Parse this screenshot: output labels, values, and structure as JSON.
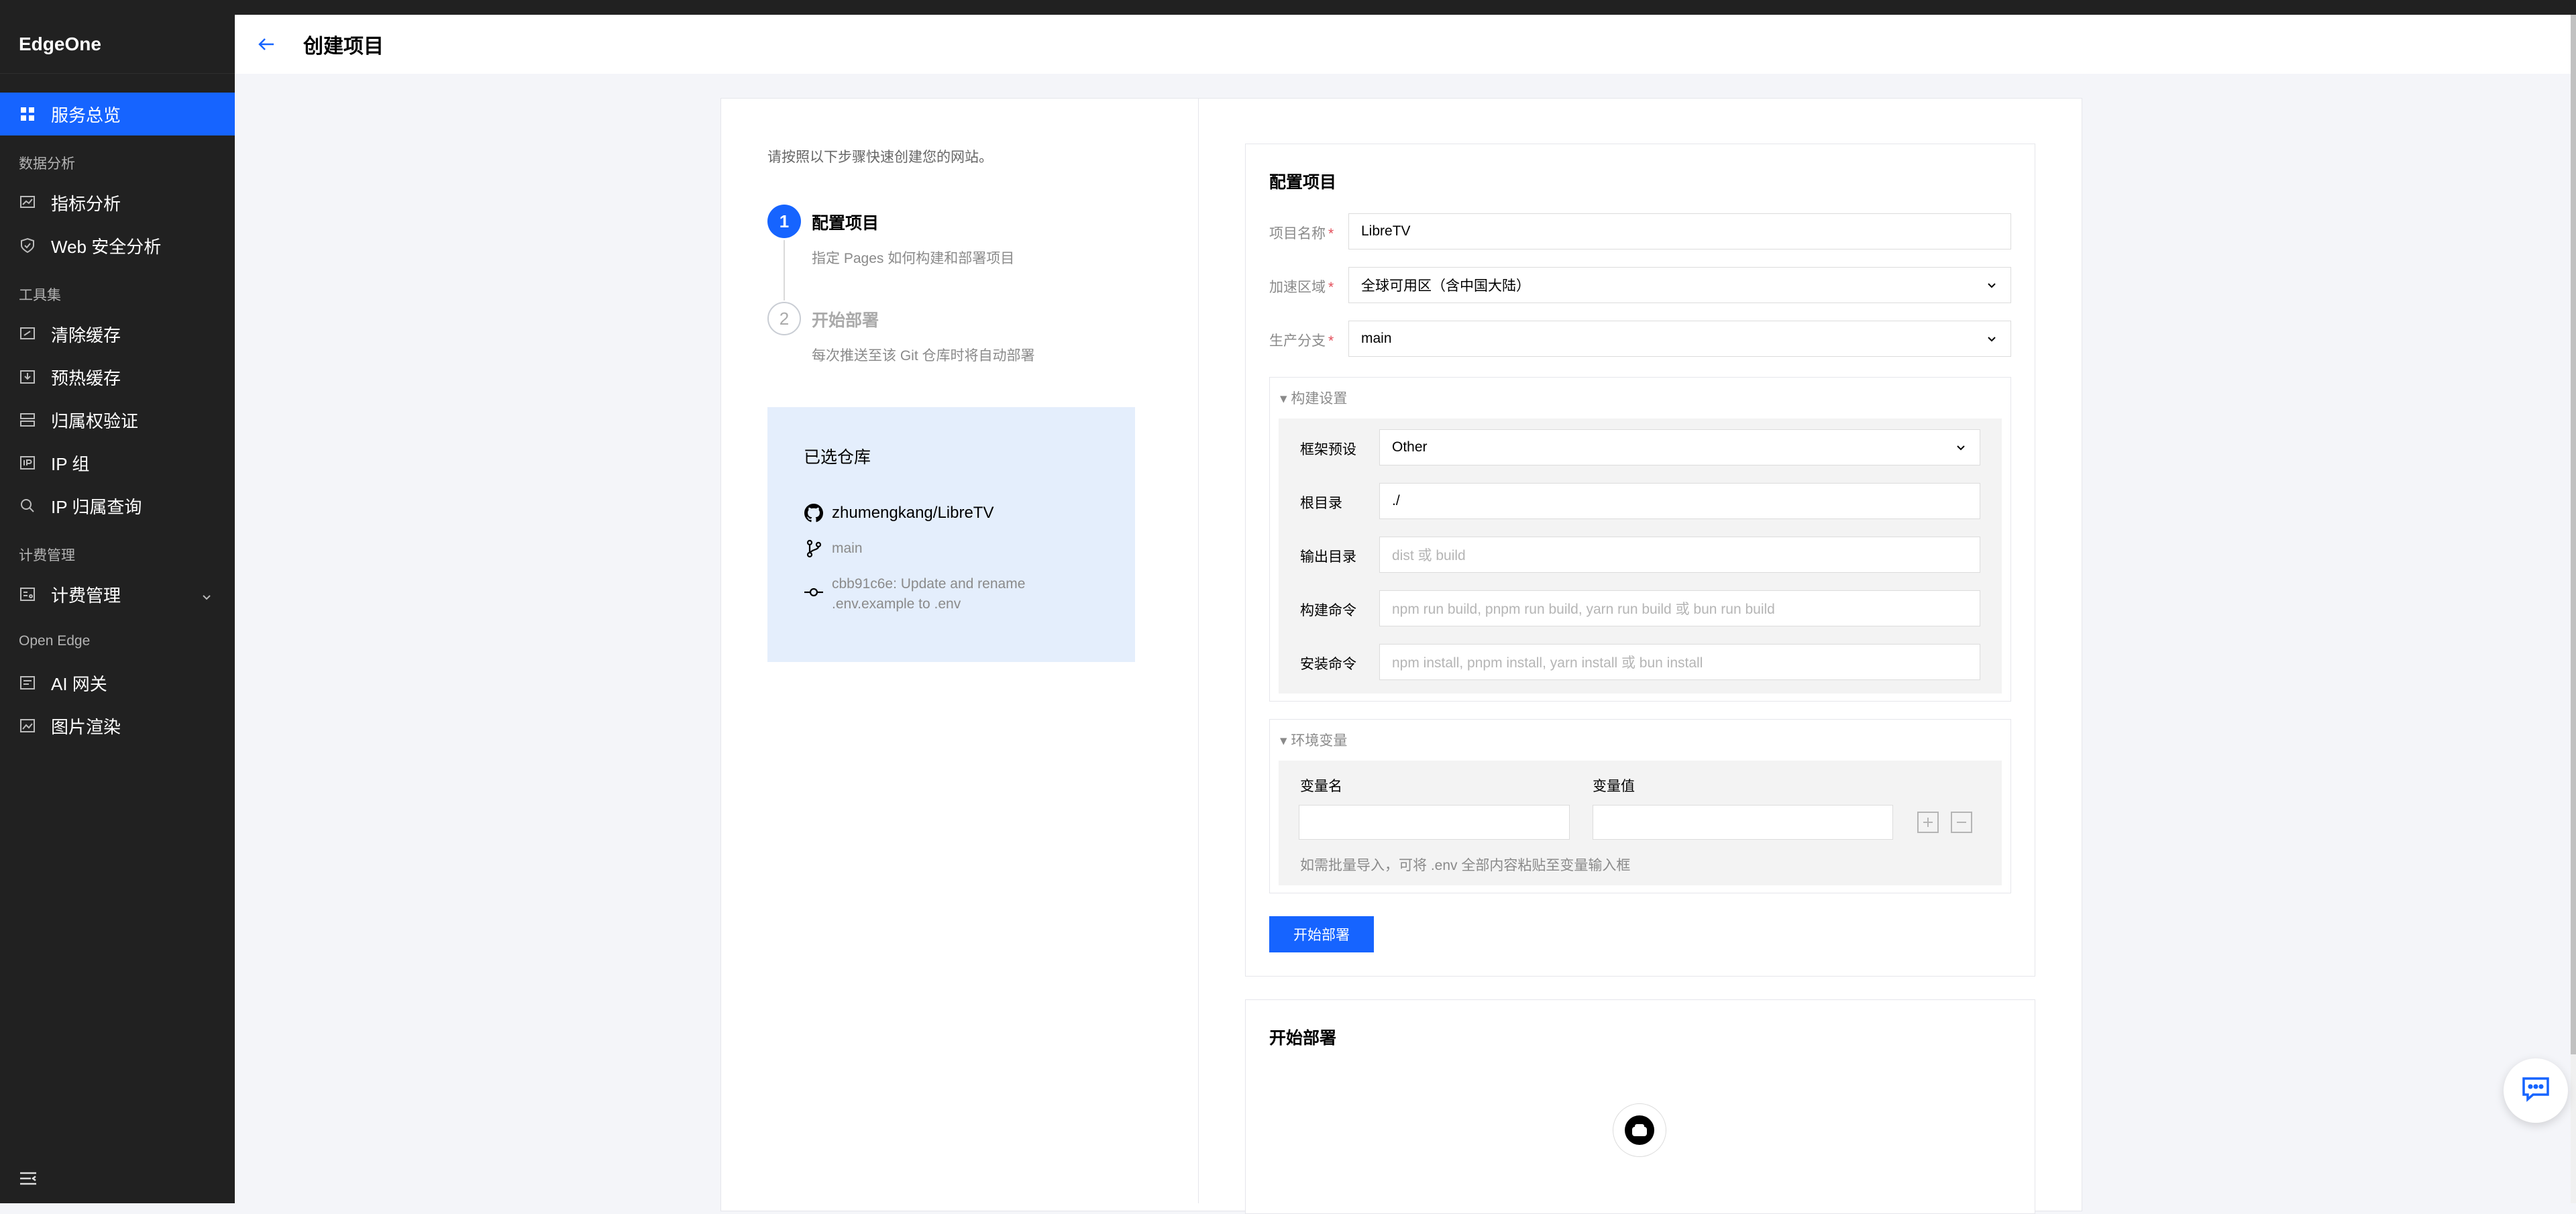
{
  "app": {
    "brand": "EdgeOne"
  },
  "sidebar": {
    "items": [
      {
        "label": "服务总览"
      },
      {
        "label": "指标分析"
      },
      {
        "label": "Web 安全分析"
      },
      {
        "label": "清除缓存"
      },
      {
        "label": "预热缓存"
      },
      {
        "label": "归属权验证"
      },
      {
        "label": "IP 组"
      },
      {
        "label": "IP 归属查询"
      },
      {
        "label": "计费管理"
      },
      {
        "label": "AI 网关"
      },
      {
        "label": "图片渲染"
      }
    ],
    "groups": [
      "数据分析",
      "工具集",
      "计费管理",
      "Open Edge"
    ]
  },
  "header": {
    "title": "创建项目"
  },
  "intro": "请按照以下步骤快速创建您的网站。",
  "steps": [
    {
      "number": "1",
      "title": "配置项目",
      "desc": "指定 Pages 如何构建和部署项目"
    },
    {
      "number": "2",
      "title": "开始部署",
      "desc": "每次推送至该 Git 仓库时将自动部署"
    }
  ],
  "repo": {
    "title": "已选仓库",
    "name": "zhumengkang/LibreTV",
    "branch": "main",
    "commit_line1": "cbb91c6e: Update and rename",
    "commit_line2": ".env.example to .env"
  },
  "form": {
    "title": "配置项目",
    "project_name": {
      "label": "项目名称",
      "value": "LibreTV"
    },
    "region": {
      "label": "加速区域",
      "value": "全球可用区（含中国大陆）"
    },
    "branch": {
      "label": "生产分支",
      "value": "main"
    },
    "build": {
      "title": "构建设置",
      "framework": {
        "label": "框架预设",
        "value": "Other"
      },
      "root": {
        "label": "根目录",
        "value": "./"
      },
      "output": {
        "label": "输出目录",
        "placeholder": "dist 或 build"
      },
      "build_cmd": {
        "label": "构建命令",
        "placeholder": "npm run build, pnpm run build, yarn run build 或 bun run build"
      },
      "install_cmd": {
        "label": "安装命令",
        "placeholder": "npm install, pnpm install, yarn install 或 bun install"
      }
    },
    "env": {
      "title": "环境变量",
      "name_label": "变量名",
      "value_label": "变量值",
      "hint": "如需批量导入，可将 .env 全部内容粘贴至变量输入框"
    },
    "submit": "开始部署"
  },
  "deploy": {
    "title": "开始部署"
  },
  "colors": {
    "primary": "#1664ff",
    "sidebar": "#212121",
    "repo_bg": "#e4eefc"
  }
}
